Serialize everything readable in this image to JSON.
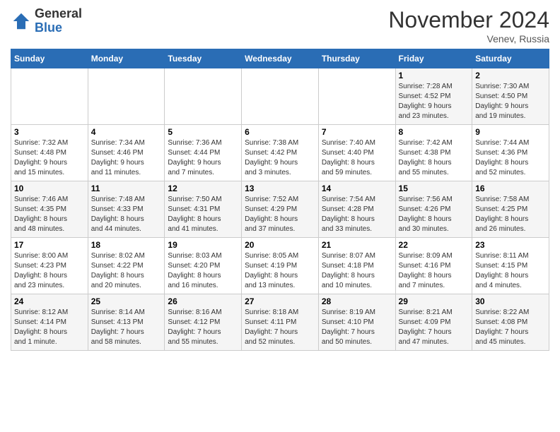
{
  "header": {
    "logo_general": "General",
    "logo_blue": "Blue",
    "month_title": "November 2024",
    "location": "Venev, Russia"
  },
  "days_of_week": [
    "Sunday",
    "Monday",
    "Tuesday",
    "Wednesday",
    "Thursday",
    "Friday",
    "Saturday"
  ],
  "weeks": [
    [
      {
        "day": "",
        "info": ""
      },
      {
        "day": "",
        "info": ""
      },
      {
        "day": "",
        "info": ""
      },
      {
        "day": "",
        "info": ""
      },
      {
        "day": "",
        "info": ""
      },
      {
        "day": "1",
        "info": "Sunrise: 7:28 AM\nSunset: 4:52 PM\nDaylight: 9 hours\nand 23 minutes."
      },
      {
        "day": "2",
        "info": "Sunrise: 7:30 AM\nSunset: 4:50 PM\nDaylight: 9 hours\nand 19 minutes."
      }
    ],
    [
      {
        "day": "3",
        "info": "Sunrise: 7:32 AM\nSunset: 4:48 PM\nDaylight: 9 hours\nand 15 minutes."
      },
      {
        "day": "4",
        "info": "Sunrise: 7:34 AM\nSunset: 4:46 PM\nDaylight: 9 hours\nand 11 minutes."
      },
      {
        "day": "5",
        "info": "Sunrise: 7:36 AM\nSunset: 4:44 PM\nDaylight: 9 hours\nand 7 minutes."
      },
      {
        "day": "6",
        "info": "Sunrise: 7:38 AM\nSunset: 4:42 PM\nDaylight: 9 hours\nand 3 minutes."
      },
      {
        "day": "7",
        "info": "Sunrise: 7:40 AM\nSunset: 4:40 PM\nDaylight: 8 hours\nand 59 minutes."
      },
      {
        "day": "8",
        "info": "Sunrise: 7:42 AM\nSunset: 4:38 PM\nDaylight: 8 hours\nand 55 minutes."
      },
      {
        "day": "9",
        "info": "Sunrise: 7:44 AM\nSunset: 4:36 PM\nDaylight: 8 hours\nand 52 minutes."
      }
    ],
    [
      {
        "day": "10",
        "info": "Sunrise: 7:46 AM\nSunset: 4:35 PM\nDaylight: 8 hours\nand 48 minutes."
      },
      {
        "day": "11",
        "info": "Sunrise: 7:48 AM\nSunset: 4:33 PM\nDaylight: 8 hours\nand 44 minutes."
      },
      {
        "day": "12",
        "info": "Sunrise: 7:50 AM\nSunset: 4:31 PM\nDaylight: 8 hours\nand 41 minutes."
      },
      {
        "day": "13",
        "info": "Sunrise: 7:52 AM\nSunset: 4:29 PM\nDaylight: 8 hours\nand 37 minutes."
      },
      {
        "day": "14",
        "info": "Sunrise: 7:54 AM\nSunset: 4:28 PM\nDaylight: 8 hours\nand 33 minutes."
      },
      {
        "day": "15",
        "info": "Sunrise: 7:56 AM\nSunset: 4:26 PM\nDaylight: 8 hours\nand 30 minutes."
      },
      {
        "day": "16",
        "info": "Sunrise: 7:58 AM\nSunset: 4:25 PM\nDaylight: 8 hours\nand 26 minutes."
      }
    ],
    [
      {
        "day": "17",
        "info": "Sunrise: 8:00 AM\nSunset: 4:23 PM\nDaylight: 8 hours\nand 23 minutes."
      },
      {
        "day": "18",
        "info": "Sunrise: 8:02 AM\nSunset: 4:22 PM\nDaylight: 8 hours\nand 20 minutes."
      },
      {
        "day": "19",
        "info": "Sunrise: 8:03 AM\nSunset: 4:20 PM\nDaylight: 8 hours\nand 16 minutes."
      },
      {
        "day": "20",
        "info": "Sunrise: 8:05 AM\nSunset: 4:19 PM\nDaylight: 8 hours\nand 13 minutes."
      },
      {
        "day": "21",
        "info": "Sunrise: 8:07 AM\nSunset: 4:18 PM\nDaylight: 8 hours\nand 10 minutes."
      },
      {
        "day": "22",
        "info": "Sunrise: 8:09 AM\nSunset: 4:16 PM\nDaylight: 8 hours\nand 7 minutes."
      },
      {
        "day": "23",
        "info": "Sunrise: 8:11 AM\nSunset: 4:15 PM\nDaylight: 8 hours\nand 4 minutes."
      }
    ],
    [
      {
        "day": "24",
        "info": "Sunrise: 8:12 AM\nSunset: 4:14 PM\nDaylight: 8 hours\nand 1 minute."
      },
      {
        "day": "25",
        "info": "Sunrise: 8:14 AM\nSunset: 4:13 PM\nDaylight: 7 hours\nand 58 minutes."
      },
      {
        "day": "26",
        "info": "Sunrise: 8:16 AM\nSunset: 4:12 PM\nDaylight: 7 hours\nand 55 minutes."
      },
      {
        "day": "27",
        "info": "Sunrise: 8:18 AM\nSunset: 4:11 PM\nDaylight: 7 hours\nand 52 minutes."
      },
      {
        "day": "28",
        "info": "Sunrise: 8:19 AM\nSunset: 4:10 PM\nDaylight: 7 hours\nand 50 minutes."
      },
      {
        "day": "29",
        "info": "Sunrise: 8:21 AM\nSunset: 4:09 PM\nDaylight: 7 hours\nand 47 minutes."
      },
      {
        "day": "30",
        "info": "Sunrise: 8:22 AM\nSunset: 4:08 PM\nDaylight: 7 hours\nand 45 minutes."
      }
    ]
  ]
}
